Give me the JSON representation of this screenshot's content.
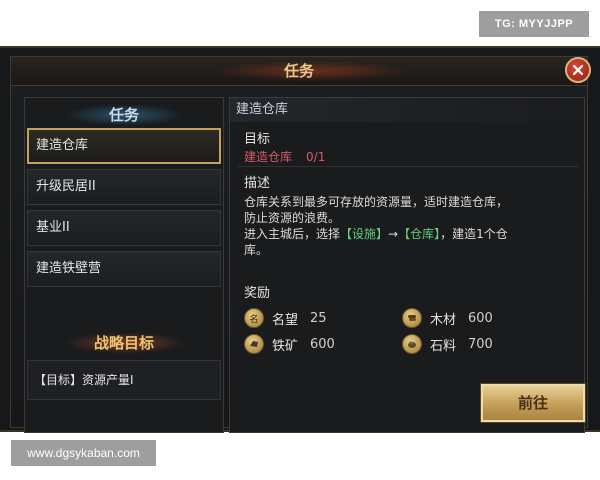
{
  "tags": {
    "top_right": "TG: MYYJJPP",
    "bottom_left": "www.dgsykaban.com"
  },
  "window": {
    "title": "任务",
    "close_icon": "close-icon"
  },
  "left": {
    "tasks_header": "任务",
    "tasks": [
      {
        "label": "建造仓库",
        "active": true
      },
      {
        "label": "升级民居II",
        "active": false
      },
      {
        "label": "基业II",
        "active": false
      },
      {
        "label": "建造铁壁营",
        "active": false
      }
    ],
    "strategy_header": "战略目标",
    "strategy_goal": "【目标】资源产量I"
  },
  "detail": {
    "task_name": "建造仓库",
    "objective_label": "目标",
    "objective_text": "建造仓库",
    "objective_progress": "0/1",
    "desc_label": "描述",
    "desc_line1": "仓库关系到最多可存放的资源量，适时建造仓库，",
    "desc_line2": "防止资源的浪费。",
    "desc_line3_pre": "进入主城后，选择",
    "desc_link1": "【设施】",
    "desc_arrow": "→",
    "desc_link2": "【仓库】",
    "desc_line3_post": "，建造1个仓",
    "desc_line4": "库。",
    "reward_label": "奖励",
    "rewards": [
      {
        "icon": "prestige-icon",
        "name": "名望",
        "amount": "25"
      },
      {
        "icon": "wood-icon",
        "name": "木材",
        "amount": "600"
      },
      {
        "icon": "iron-icon",
        "name": "铁矿",
        "amount": "600"
      },
      {
        "icon": "stone-icon",
        "name": "石料",
        "amount": "700"
      }
    ],
    "go_button": "前往"
  },
  "colors": {
    "accent_gold": "#c7a15a",
    "objective_red": "#d55a6a",
    "link_green": "#5fd07a",
    "close_red": "#b8332a"
  }
}
